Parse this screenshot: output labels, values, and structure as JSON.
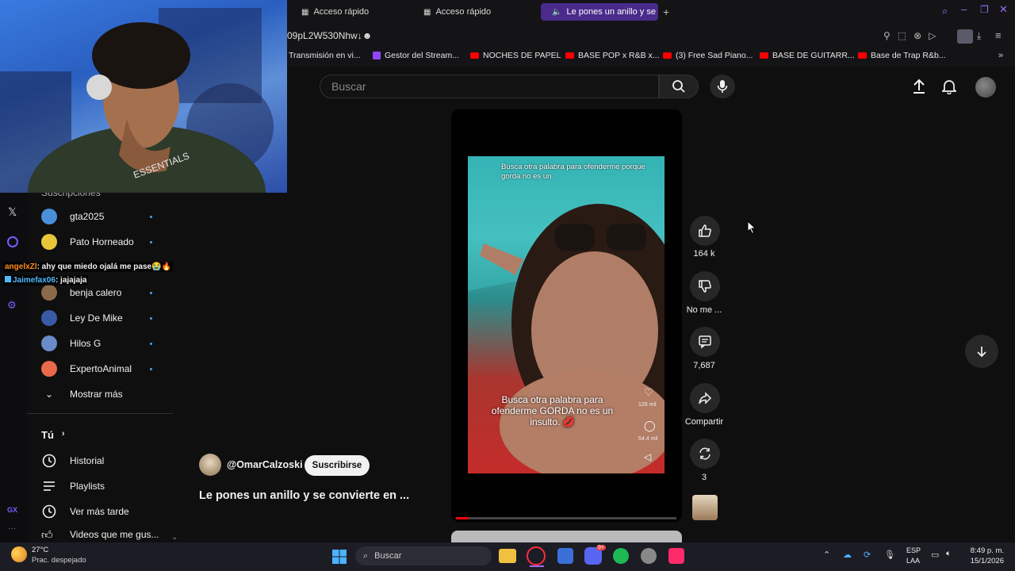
{
  "browser": {
    "tabs": [
      {
        "label": "Acceso rápido"
      },
      {
        "label": "Acceso rápido"
      },
      {
        "label": "Le pones un anillo y se"
      }
    ],
    "url": "09pL2W530Nhw↓☻",
    "bookmarks": [
      {
        "label": "Transmisión en vi...",
        "icon": "none"
      },
      {
        "label": "Gestor del Stream...",
        "icon": "twitch-icon"
      },
      {
        "label": "NOCHES DE PAPEL",
        "icon": "youtube-icon"
      },
      {
        "label": "BASE POP x R&B x...",
        "icon": "youtube-icon"
      },
      {
        "label": "(3) Free Sad Piano...",
        "icon": "youtube-icon"
      },
      {
        "label": "BASE DE GUITARR...",
        "icon": "youtube-icon"
      },
      {
        "label": "Base de Trap R&b...",
        "icon": "youtube-icon"
      }
    ]
  },
  "header": {
    "search_placeholder": "Buscar"
  },
  "sidebar": {
    "section_cut": "Suscripciones",
    "subscriptions": [
      {
        "label": "gta2025",
        "color": "#4a90d9"
      },
      {
        "label": "Pato Horneado",
        "color": "#e8c63a"
      },
      {
        "label": "benja calero",
        "color": "#8a6a4a"
      },
      {
        "label": "Ley De Mike",
        "color": "#3a5aa8"
      },
      {
        "label": "Hilos G",
        "color": "#6a8ac8"
      },
      {
        "label": "ExpertoAnimal",
        "color": "#e86a4a"
      }
    ],
    "show_more": "Mostrar más",
    "you_heading": "Tú",
    "you_items": [
      {
        "label": "Historial"
      },
      {
        "label": "Playlists"
      },
      {
        "label": "Ver más tarde"
      },
      {
        "label": "Videos que me gus..."
      }
    ]
  },
  "chat": [
    {
      "user": "angelxZl",
      "message": ": ahy que miedo ojalá me pase😭🔥",
      "color": "#ff8c1a"
    },
    {
      "user": "Jaimefax06",
      "message": ": jajajaja",
      "color": "#4fb8ff"
    }
  ],
  "short": {
    "caption_top": "Busca otra palabra para ofenderme porque gorda no es un",
    "caption_bottom": "Busca otra palabra para ofenderme GORDA no es un insulto. 💋",
    "inner_likes": "126 mil",
    "inner_comments": "54.4 mil",
    "channel": "@OmarCalzoski",
    "subscribe_label": "Suscribirse",
    "title": "Le pones un anillo y se convierte en ...",
    "actions": {
      "likes": "164 k",
      "dislike_label": "No me ...",
      "comments": "7,687",
      "share_label": "Compartir",
      "remix_count": "3"
    }
  },
  "taskbar": {
    "weather_temp": "27°C",
    "weather_desc": "Prac. despejado",
    "search_label": "Buscar",
    "language": "ESP",
    "layout": "LAA",
    "time": "8:49 p. m.",
    "date": "15/1/2026",
    "discord_badge": "9+"
  }
}
